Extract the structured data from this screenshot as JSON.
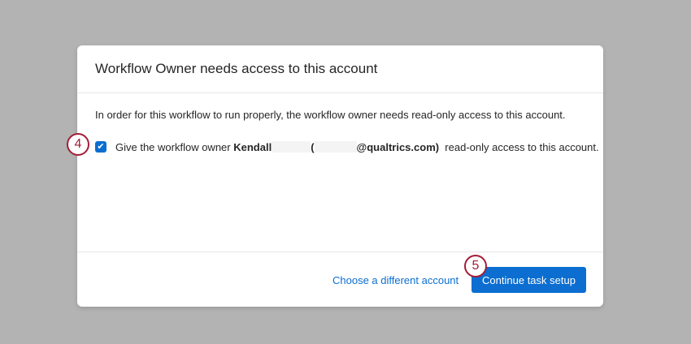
{
  "dialog": {
    "title": "Workflow Owner needs access to this account",
    "description": "In order for this workflow to run properly, the workflow owner needs read-only access to this account.",
    "checkbox": {
      "checked": true,
      "prefix": "Give the workflow owner ",
      "name": "Kendall",
      "open_paren": "(",
      "email_domain": "@qualtrics.com)",
      "suffix": "  read-only access to this account."
    },
    "link_label": "Choose a different account",
    "button_label": "Continue task setup"
  },
  "annotations": [
    "4",
    "5"
  ],
  "colors": {
    "accent": "#0b6ed0",
    "badge": "#a51d36"
  }
}
